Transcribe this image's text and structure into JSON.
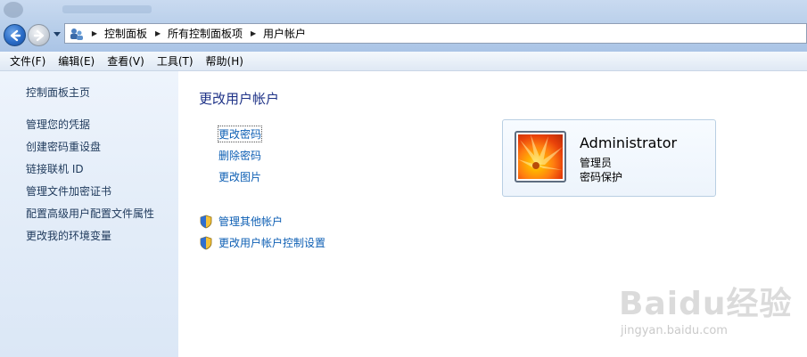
{
  "window": {
    "title_blurred": ""
  },
  "address": {
    "icon": "control-panel-icon",
    "breadcrumbs": [
      "控制面板",
      "所有控制面板项",
      "用户帐户"
    ]
  },
  "menu": {
    "items": [
      "文件(F)",
      "编辑(E)",
      "查看(V)",
      "工具(T)",
      "帮助(H)"
    ]
  },
  "sidebar": {
    "home": "控制面板主页",
    "items": [
      "管理您的凭据",
      "创建密码重设盘",
      "链接联机 ID",
      "管理文件加密证书",
      "配置高级用户配置文件属性",
      "更改我的环境变量"
    ]
  },
  "main": {
    "title": "更改用户帐户",
    "tasks": [
      "更改密码",
      "删除密码",
      "更改图片"
    ],
    "shield_tasks": [
      "管理其他帐户",
      "更改用户帐户控制设置"
    ]
  },
  "user": {
    "name": "Administrator",
    "role": "管理员",
    "status": "密码保护"
  },
  "watermark": {
    "main": "Baidu经验",
    "sub": "jingyan.baidu.com"
  },
  "colors": {
    "link": "#0e5fb4",
    "title": "#1e3287",
    "sidebar_bg": "#e5eef9"
  }
}
